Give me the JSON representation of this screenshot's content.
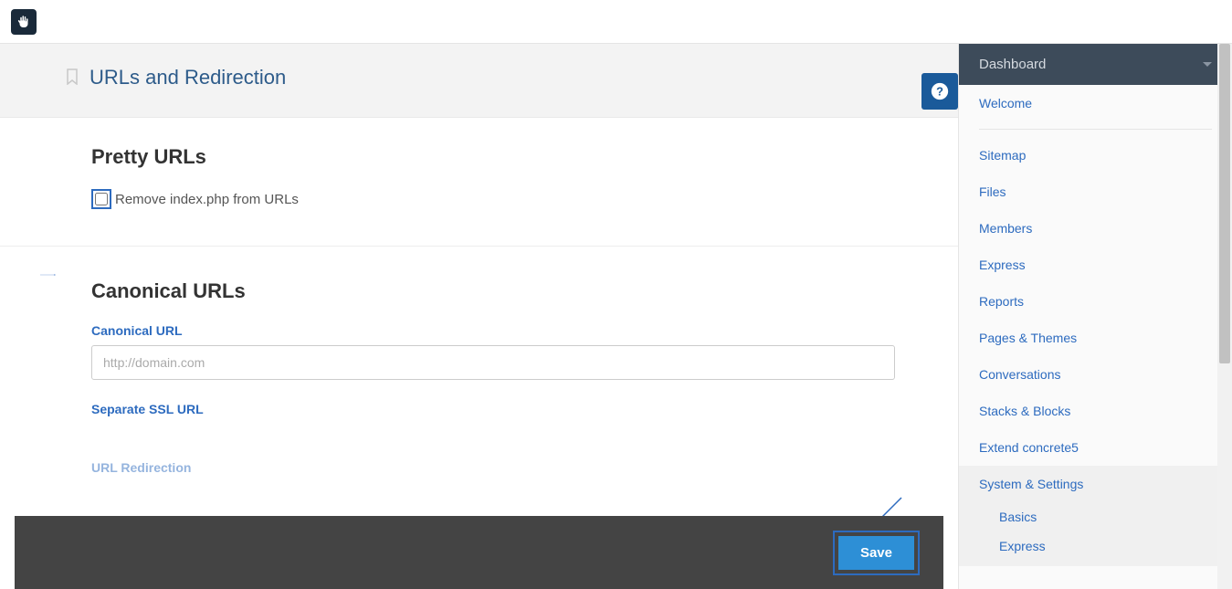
{
  "page": {
    "title": "URLs and Redirection"
  },
  "sections": {
    "pretty_urls": {
      "title": "Pretty URLs",
      "checkbox_label": "Remove index.php from URLs"
    },
    "canonical": {
      "title": "Canonical URLs",
      "url_label": "Canonical URL",
      "url_placeholder": "http://domain.com",
      "ssl_label": "Separate SSL URL",
      "redirect_label": "URL Redirection"
    }
  },
  "footer": {
    "save": "Save"
  },
  "sidebar": {
    "header": "Dashboard",
    "welcome": "Welcome",
    "items": [
      "Sitemap",
      "Files",
      "Members",
      "Express",
      "Reports",
      "Pages & Themes",
      "Conversations",
      "Stacks & Blocks",
      "Extend concrete5",
      "System & Settings"
    ],
    "sub": [
      "Basics",
      "Express"
    ]
  }
}
